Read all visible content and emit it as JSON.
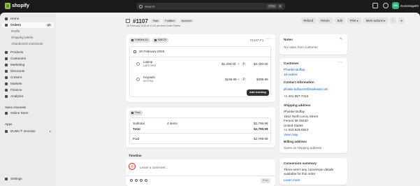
{
  "topbar": {
    "brand": "shopify",
    "search_placeholder": "Search",
    "shortcut_keys": [
      "CTRL",
      "K"
    ],
    "user_initials": "GS",
    "user_name": "GumoSage83"
  },
  "sidebar": {
    "items": [
      {
        "label": "Home",
        "icon": "home-icon"
      },
      {
        "label": "Orders",
        "icon": "orders-icon",
        "badge": "47",
        "active": true
      },
      {
        "label": "Drafts",
        "sub": true
      },
      {
        "label": "Shipping labels",
        "sub": true
      },
      {
        "label": "Abandoned checkouts",
        "sub": true
      },
      {
        "label": "Products",
        "icon": "tag-icon"
      },
      {
        "label": "Customers",
        "icon": "person-icon"
      },
      {
        "label": "Marketing",
        "icon": "target-icon"
      },
      {
        "label": "Discounts",
        "icon": "discount-icon"
      },
      {
        "label": "Content",
        "icon": "content-icon"
      },
      {
        "label": "Markets",
        "icon": "globe-icon"
      },
      {
        "label": "Finance",
        "icon": "bank-icon"
      },
      {
        "label": "Analytics",
        "icon": "chart-icon"
      }
    ],
    "sales_channels_label": "Sales channels",
    "online_store": "Online Store",
    "apps_label": "Apps",
    "app_item": "DUMo™ Doculos",
    "settings": "Settings"
  },
  "header": {
    "order_number": "#1107",
    "status_paid": "Paid",
    "status_fulfilled": "Fulfilled",
    "status_archived": "Archived",
    "subline": "16 February 2026 at 11:29 pm from Draft Orders",
    "buttons": {
      "refund": "Refund",
      "return": "Return",
      "edit": "Edit",
      "print": "Print",
      "more": "More actions"
    }
  },
  "fulfillment": {
    "tag_fulfilled": "Fulfilled (4)",
    "tag_location": "NAEZS",
    "ref": "#1107-F1",
    "date": "20 February 2026",
    "items": [
      {
        "name": "Laptop",
        "variant": "LAPTOP05",
        "unit_price": "$1,200.00",
        "qty": "2",
        "total": "$2,400.00"
      },
      {
        "name": "Keypads",
        "variant": "KEYPAD",
        "unit_price": "$199.99",
        "qty": "2",
        "total": "$399.99"
      }
    ],
    "add_tracking": "Add tracking"
  },
  "payment": {
    "tag_paid": "Paid",
    "subtotal_label": "Subtotal",
    "subtotal_items": "4 items",
    "subtotal_value": "$2,799.99",
    "total_label": "Total",
    "total_value": "$2,799.99",
    "paid_label": "Paid",
    "paid_value": "$2,799.99"
  },
  "notes": {
    "title": "Notes",
    "text": "No notes from customer"
  },
  "customer": {
    "title": "Customer",
    "name": "Phoebe Buffay",
    "orders": "15 orders",
    "contact_title": "Contact information",
    "email": "phoebe.buffay123@mailinator.com",
    "phone": "+1 341-867-7316",
    "shipping_title": "Shipping address",
    "address_lines": [
      "Phoebe Buffay",
      "1542 North Leroy Street",
      "Fenton MI 48430",
      "United States",
      "+1 810-629-0923"
    ],
    "view_map": "View map",
    "billing_title": "Billing address",
    "billing_text": "Same as shipping address"
  },
  "conversion": {
    "title": "Conversion summary",
    "text_line1": "There aren't any conversion details",
    "text_line2": "available for this order",
    "learn_more": "Learn more"
  },
  "timeline": {
    "title": "Timeline",
    "placeholder": "Leave a comment...",
    "post": "Post"
  }
}
